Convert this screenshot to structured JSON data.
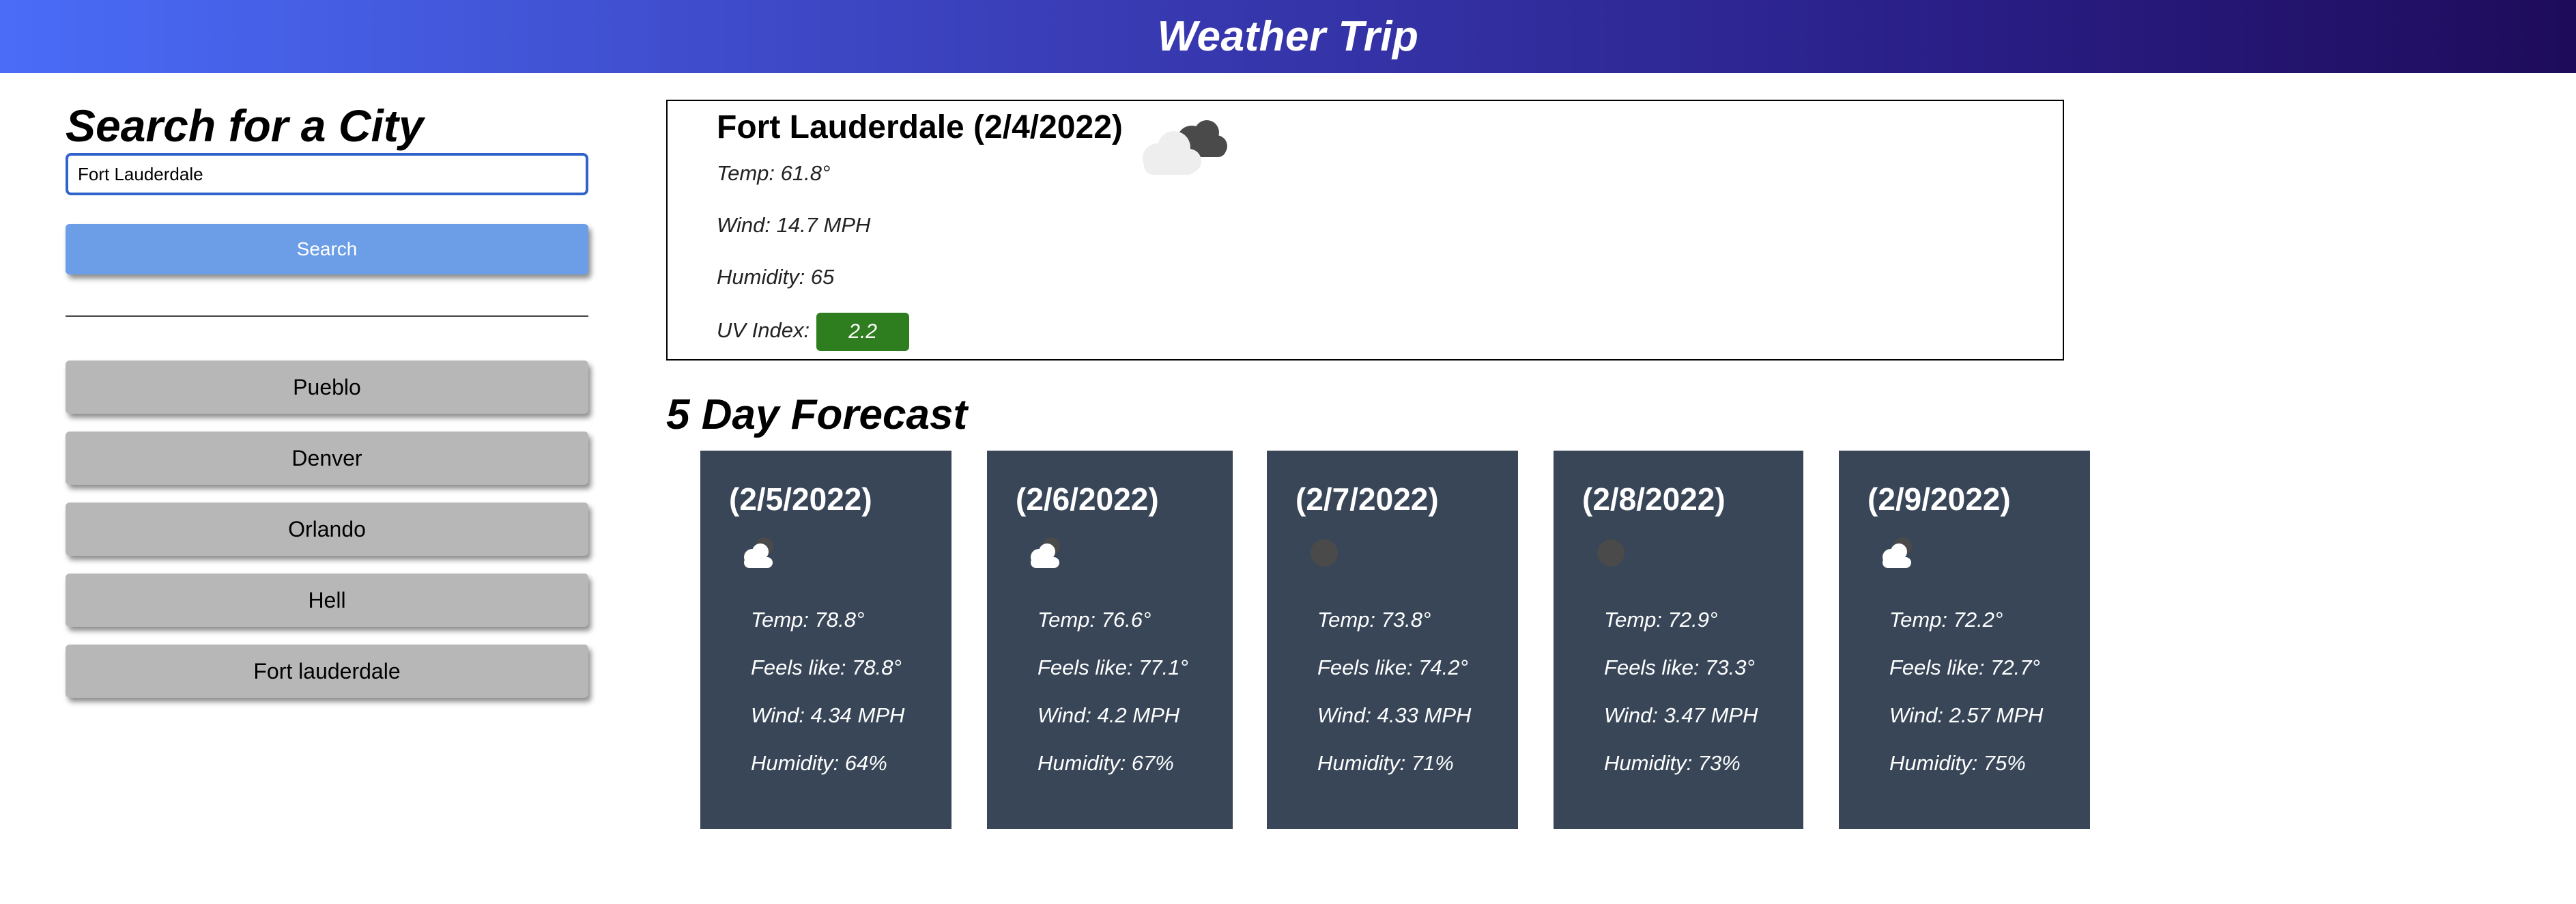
{
  "header": {
    "title": "Weather Trip"
  },
  "search": {
    "heading": "Search for a City",
    "input_value": "Fort Lauderdale",
    "button_label": "Search"
  },
  "history": [
    "Pueblo",
    "Denver",
    "Orlando",
    "Hell",
    "Fort lauderdale"
  ],
  "current": {
    "title": "Fort Lauderdale (2/4/2022)",
    "icon": "clouds-icon",
    "temp": "Temp: 61.8°",
    "wind": "Wind: 14.7 MPH",
    "humidity": "Humidity: 65",
    "uv_label": "UV Index:",
    "uv_value": "2.2",
    "uv_color": "#2e7d1e"
  },
  "forecast": {
    "heading": "5 Day Forecast",
    "days": [
      {
        "date": "(2/5/2022)",
        "icon": "partly-cloudy-icon",
        "temp": "Temp: 78.8°",
        "feels": "Feels like: 78.8°",
        "wind": "Wind: 4.34 MPH",
        "humidity": "Humidity: 64%"
      },
      {
        "date": "(2/6/2022)",
        "icon": "partly-cloudy-icon",
        "temp": "Temp: 76.6°",
        "feels": "Feels like: 77.1°",
        "wind": "Wind: 4.2 MPH",
        "humidity": "Humidity: 67%"
      },
      {
        "date": "(2/7/2022)",
        "icon": "overcast-icon",
        "temp": "Temp: 73.8°",
        "feels": "Feels like: 74.2°",
        "wind": "Wind: 4.33 MPH",
        "humidity": "Humidity: 71%"
      },
      {
        "date": "(2/8/2022)",
        "icon": "overcast-icon",
        "temp": "Temp: 72.9°",
        "feels": "Feels like: 73.3°",
        "wind": "Wind: 3.47 MPH",
        "humidity": "Humidity: 73%"
      },
      {
        "date": "(2/9/2022)",
        "icon": "partly-cloudy-icon",
        "temp": "Temp: 72.2°",
        "feels": "Feels like: 72.7°",
        "wind": "Wind: 2.57 MPH",
        "humidity": "Humidity: 75%"
      }
    ]
  },
  "colors": {
    "header_start": "#4a6cf7",
    "header_end": "#1e0b5a",
    "search_button": "#6c9ee8",
    "history_button": "#b7b7b7",
    "forecast_card": "#384658"
  }
}
